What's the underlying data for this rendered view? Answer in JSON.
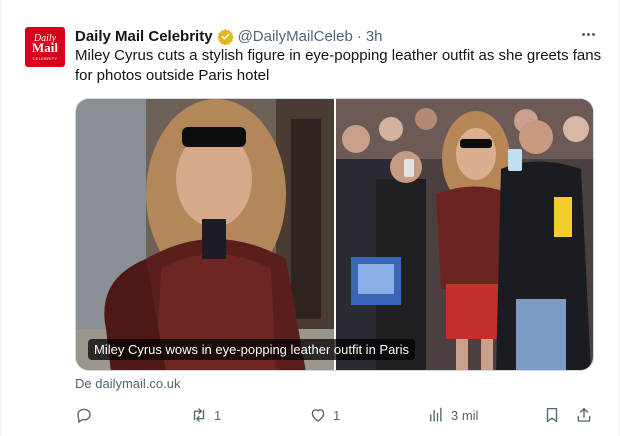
{
  "account": {
    "name": "Daily Mail Celebrity",
    "handle": "@DailyMailCeleb",
    "separator": "·",
    "time": "3h",
    "avatar_text": {
      "top": "Daily",
      "main": "Mail",
      "sub": "CELEBRITY"
    }
  },
  "tweet": {
    "text": "Miley Cyrus cuts a stylish figure in eye-popping leather outfit as she greets fans for photos outside Paris hotel",
    "caption": "Miley Cyrus wows in eye-popping leather outfit in Paris",
    "source": "De dailymail.co.uk"
  },
  "actions": {
    "reply_count": "",
    "retweet_count": "1",
    "like_count": "1",
    "views_count": "3 mil"
  },
  "colors": {
    "brand_red": "#d6001c",
    "verified_gold": "#e2b719",
    "muted_text": "#536471",
    "border": "#cfd9de"
  },
  "icons": [
    "verified-badge-icon",
    "more-icon",
    "reply-icon",
    "retweet-icon",
    "like-icon",
    "views-icon",
    "bookmark-icon",
    "share-icon"
  ]
}
